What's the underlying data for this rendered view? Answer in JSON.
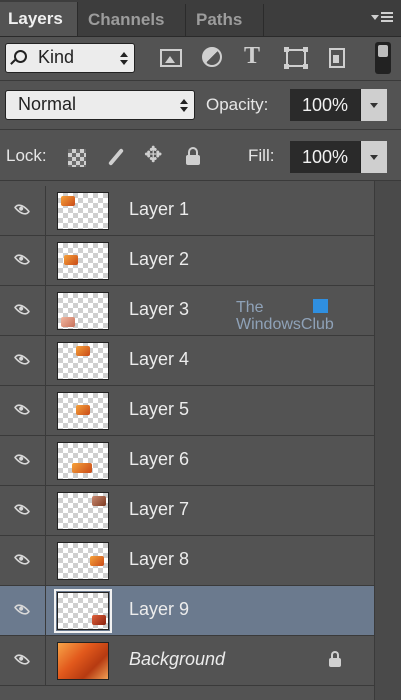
{
  "tabs": [
    {
      "label": "Layers",
      "active": true
    },
    {
      "label": "Channels",
      "active": false
    },
    {
      "label": "Paths",
      "active": false
    }
  ],
  "filter": {
    "kind_label": "Kind"
  },
  "blend": {
    "mode": "Normal",
    "opacity_label": "Opacity:",
    "opacity_value": "100%"
  },
  "lock": {
    "label": "Lock:",
    "fill_label": "Fill:",
    "fill_value": "100%"
  },
  "layers": [
    {
      "name": "Layer 1",
      "visible": true,
      "selected": false
    },
    {
      "name": "Layer 2",
      "visible": true,
      "selected": false
    },
    {
      "name": "Layer 3",
      "visible": true,
      "selected": false
    },
    {
      "name": "Layer 4",
      "visible": true,
      "selected": false
    },
    {
      "name": "Layer 5",
      "visible": true,
      "selected": false
    },
    {
      "name": "Layer 6",
      "visible": true,
      "selected": false
    },
    {
      "name": "Layer 7",
      "visible": true,
      "selected": false
    },
    {
      "name": "Layer 8",
      "visible": true,
      "selected": false
    },
    {
      "name": "Layer 9",
      "visible": true,
      "selected": true
    },
    {
      "name": "Background",
      "visible": true,
      "selected": false,
      "locked": true,
      "italic": true
    }
  ],
  "watermark": {
    "line1": "The",
    "line2": "WindowsClub"
  },
  "colors": {
    "panel_bg": "#535353",
    "selected_row": "#6b7a8e",
    "field_bg": "#2a2a2a"
  }
}
